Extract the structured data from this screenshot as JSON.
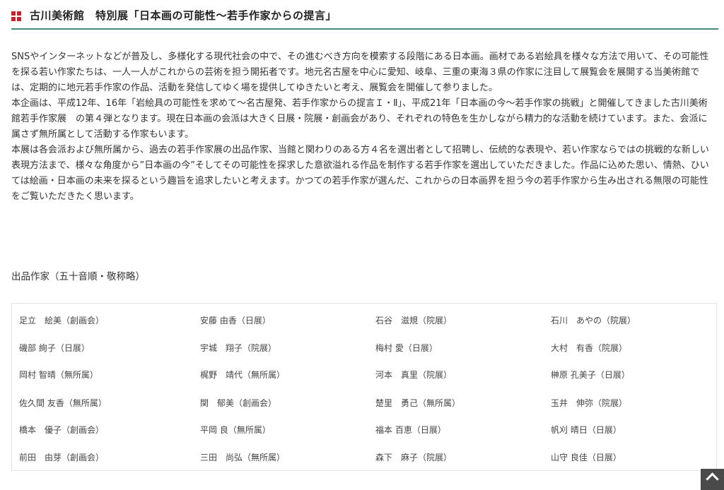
{
  "header": {
    "title": "古川美術館　特別展「日本画の可能性～若手作家からの提言」",
    "logo_icon": "red-squares-logo-icon",
    "accent_color": "#3d8c7a",
    "logo_color": "#c4232b"
  },
  "intro": {
    "paragraphs": [
      "SNSやインターネットなどが普及し、多様化する現代社会の中で、その進むべき方向を模索する段階にある日本画。画材である岩絵具を様々な方法で用いて、その可能性を探る若い作家たちは、一人一人がこれからの芸術を担う開拓者です。地元名古屋を中心に愛知、岐阜、三重の東海３県の作家に注目して展覧会を展開する当美術館では、定期的に地元若手作家の作品、活動を発信してゆく場を提供してゆきたいと考え、展覧会を開催して参りました。",
      "本企画は、平成12年、16年「岩絵具の可能性を求めて～名古屋発、若手作家からの提言Ｉ・Ⅱ」、平成21年「日本画の今～若手作家の挑戦」と開催してきました古川美術館若手作家展　の第４弾となります。現在日本画の会派は大きく日展・院展・創画会があり、それぞれの特色を生かしながら精力的な活動を続けています。また、会派に属さず無所属として活動する作家もいます。",
      "本展は各会派および無所属から、過去の若手作家展の出品作家、当館と関わりのある方４名を選出者として招聘し、伝統的な表現や、若い作家ならではの挑戦的な新しい表現方法まで、様々な角度から”日本画の今”そしてその可能性を探求した意欲溢れる作品を制作する若手作家を選出していただきました。作品に込めた思い、情熱、ひいては絵画・日本画の未来を探るという趣旨を追求したいと考えます。かつての若手作家が選んだ、これからの日本画界を担う今の若手作家から生み出される無限の可能性をご覧いただきたく思います。"
    ]
  },
  "artists": {
    "heading": "出品作家（五十音順・敬称略）",
    "rows": [
      [
        "足立　絵美（創画会）",
        "安藤 由香（日展）",
        "石谷　滋規（院展）",
        "石川　あやの（院展）"
      ],
      [
        "磯部 絢子（日展）",
        "宇城　翔子（院展）",
        "梅村 愛（日展）",
        "大村　有香（院展）"
      ],
      [
        "岡村 智晴（無所属）",
        "梶野　靖代（無所属）",
        "河本　真里（院展）",
        "榊原 孔美子（日展）"
      ],
      [
        "佐久間 友香（無所属）",
        "関　郁美（創画会）",
        "楚里　勇己（無所属）",
        "玉井　伸弥（院展）"
      ],
      [
        "橋本　優子（創画会）",
        "平岡 良（無所属）",
        "福本 百恵（日展）",
        "帆刈 晴日（日展）"
      ],
      [
        "前田　由芽（創画会）",
        "三田　尚弘（無所属）",
        "森下　麻子（院展）",
        "山守 良佳（日展）"
      ]
    ]
  },
  "scroll_top": {
    "icon": "chevron-up-icon"
  }
}
